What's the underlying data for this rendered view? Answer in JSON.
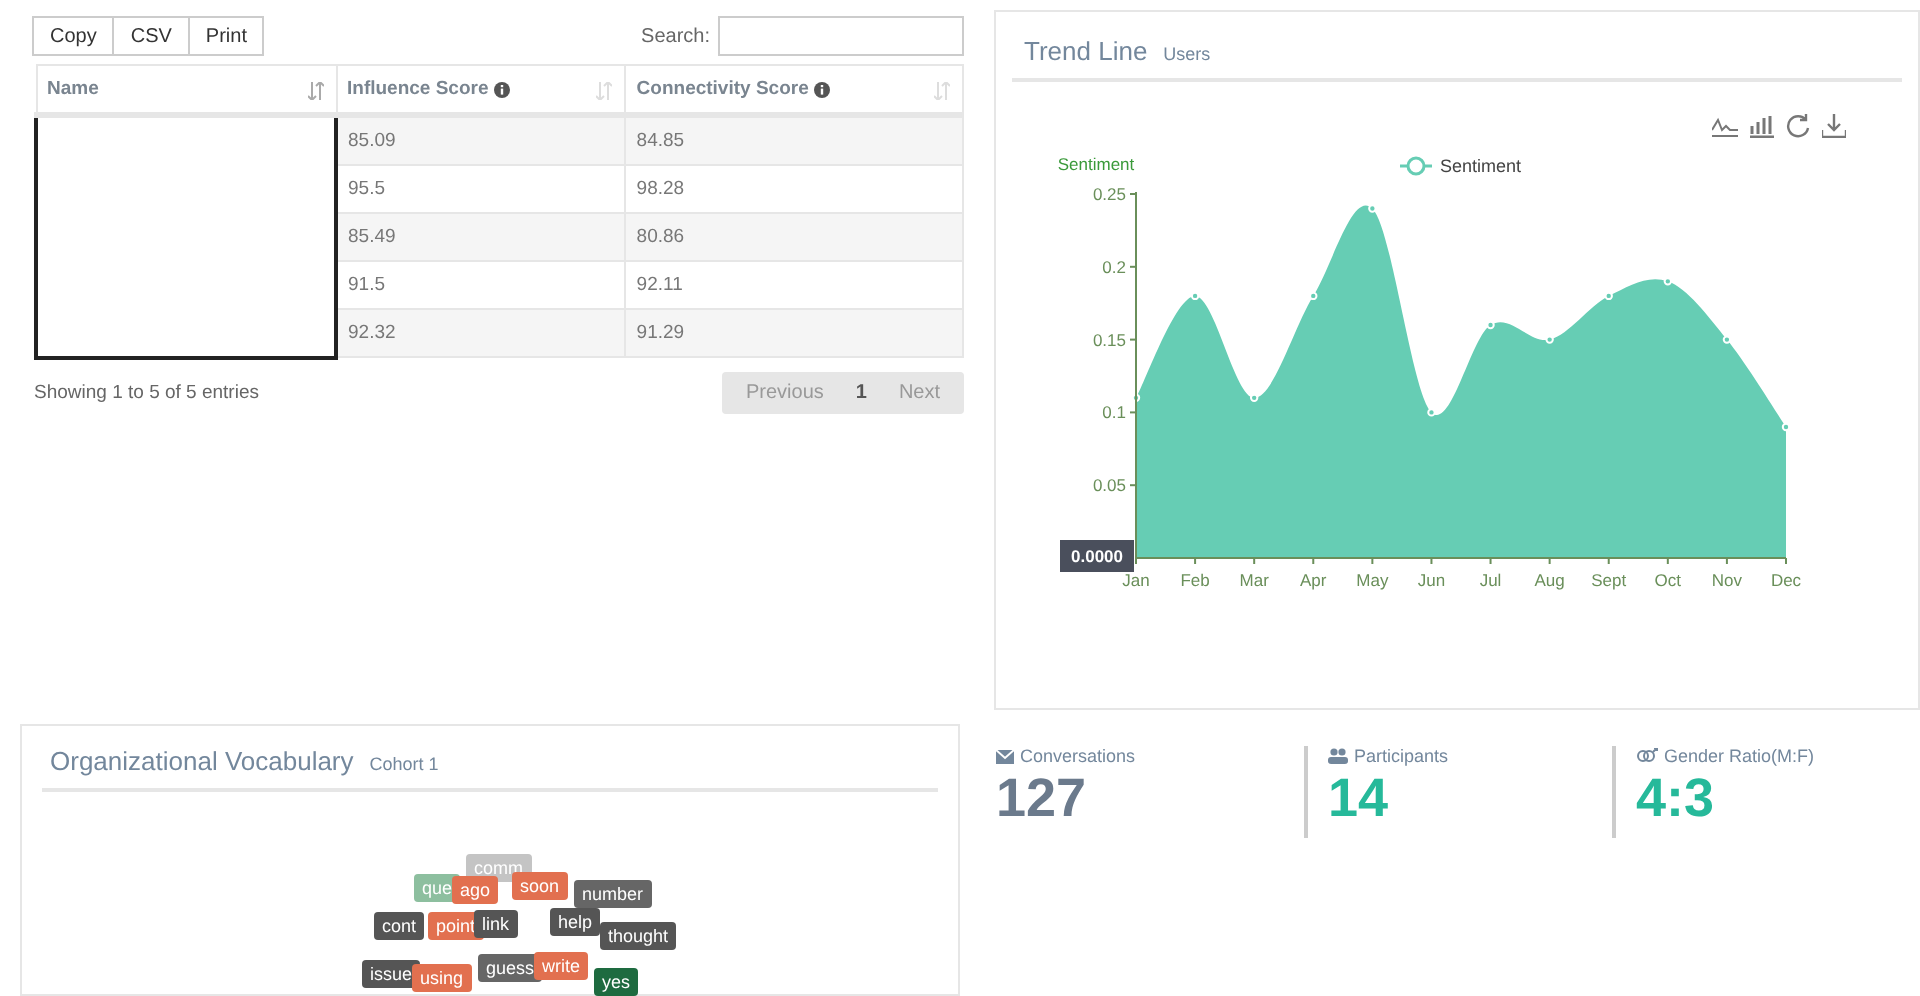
{
  "table_panel": {
    "buttons": [
      {
        "label": "Copy"
      },
      {
        "label": "CSV"
      },
      {
        "label": "Print"
      }
    ],
    "search": {
      "label": "Search:"
    },
    "columns": [
      {
        "label": "Name",
        "info": false
      },
      {
        "label": "Influence Score",
        "info": true
      },
      {
        "label": "Connectivity Score",
        "info": true
      }
    ],
    "rows": [
      {
        "influence": "85.09",
        "connectivity": "84.85"
      },
      {
        "influence": "95.5",
        "connectivity": "98.28"
      },
      {
        "influence": "85.49",
        "connectivity": "80.86"
      },
      {
        "influence": "91.5",
        "connectivity": "92.11"
      },
      {
        "influence": "92.32",
        "connectivity": "91.29"
      }
    ],
    "info": "Showing 1 to 5 of 5 entries",
    "pagination": [
      {
        "label": "Previous",
        "selected": false
      },
      {
        "label": "1",
        "selected": true
      },
      {
        "label": "Next",
        "selected": false
      }
    ]
  },
  "trend_panel": {
    "title": "Trend Line",
    "subtitle": "Users",
    "chart_data": {
      "type": "area",
      "ylabel": "Sentiment",
      "categories": [
        "Jan",
        "Feb",
        "Mar",
        "Apr",
        "May",
        "Jun",
        "Jul",
        "Aug",
        "Sept",
        "Oct",
        "Nov",
        "Dec"
      ],
      "series": [
        {
          "name": "Sentiment",
          "color": "#66cdb4",
          "values": [
            0.11,
            0.18,
            0.11,
            0.18,
            0.24,
            0.1,
            0.16,
            0.15,
            0.18,
            0.19,
            0.15,
            0.09
          ]
        }
      ],
      "ylim": [
        0,
        0.25
      ],
      "yticks": [
        0.05,
        0.1,
        0.15,
        0.2,
        0.25
      ],
      "annotations": [
        "0.0000"
      ]
    }
  },
  "vocabulary_panel": {
    "title": "Organizational Vocabulary",
    "subtitle": "Cohort 1",
    "words": [
      {
        "text": "comm",
        "color": "#c4c4c4"
      },
      {
        "text": "que",
        "color": "#8dbf9f"
      },
      {
        "text": "ago",
        "color": "#e2704f"
      },
      {
        "text": "soon",
        "color": "#e2704f"
      },
      {
        "text": "number",
        "color": "#666666"
      },
      {
        "text": "cont",
        "color": "#555555"
      },
      {
        "text": "point",
        "color": "#e2704f"
      },
      {
        "text": "link",
        "color": "#555555"
      },
      {
        "text": "help",
        "color": "#555555"
      },
      {
        "text": "thought",
        "color": "#555555"
      },
      {
        "text": "guess",
        "color": "#666666"
      },
      {
        "text": "write",
        "color": "#e2704f"
      },
      {
        "text": "issue",
        "color": "#555555"
      },
      {
        "text": "using",
        "color": "#e2704f"
      },
      {
        "text": "yes",
        "color": "#1e6b40"
      }
    ]
  },
  "stats": [
    {
      "kind": "conversations",
      "label": "Conversations",
      "value": "127"
    },
    {
      "kind": "participants",
      "label": "Participants",
      "value": "14"
    },
    {
      "kind": "gender",
      "label": "Gender Ratio(M:F)",
      "value": "4:3"
    }
  ]
}
